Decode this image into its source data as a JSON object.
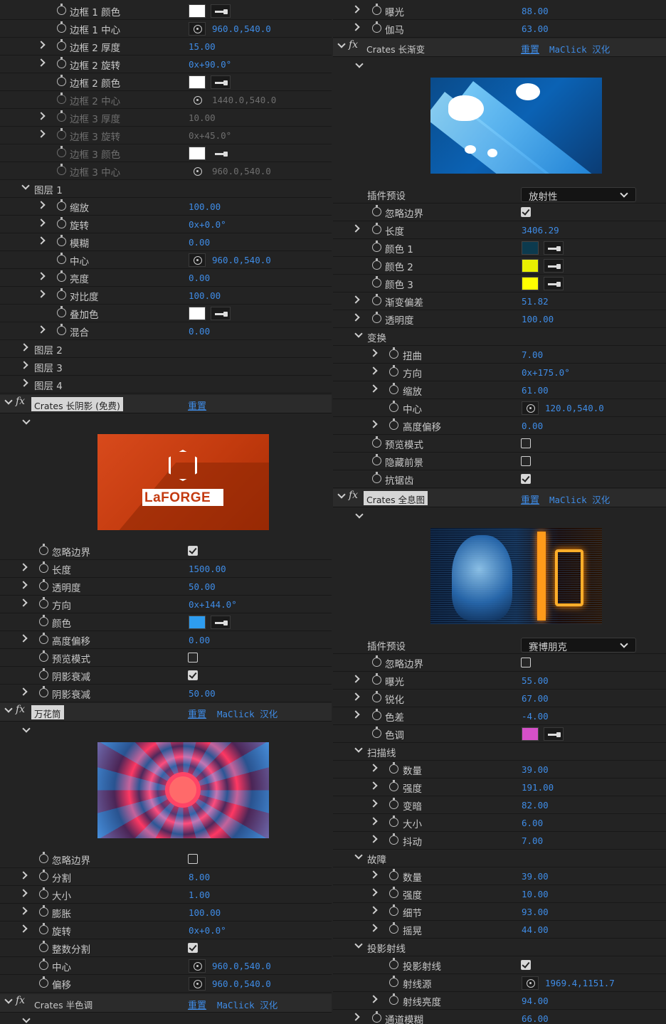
{
  "left": {
    "rows_top": [
      {
        "label": "边框 1 颜色",
        "swatch": "#ffffff"
      },
      {
        "label": "边框 1 中心",
        "value": "960.0,540.0"
      },
      {
        "label": "边框 2 厚度",
        "value": "15.00"
      },
      {
        "label": "边框 2 旋转",
        "value": "0x+90.0°"
      },
      {
        "label": "边框 2 颜色",
        "swatch": "#ffffff"
      },
      {
        "label": "边框 2 中心",
        "value": "1440.0,540.0"
      },
      {
        "label": "边框 3 厚度",
        "value": "10.00"
      },
      {
        "label": "边框 3 旋转",
        "value": "0x+45.0°"
      },
      {
        "label": "边框 3 颜色",
        "swatch": "#ffffff"
      },
      {
        "label": "边框 3 中心",
        "value": "960.0,540.0"
      },
      {
        "label": "图层 1"
      },
      {
        "label": "缩放",
        "value": "100.00"
      },
      {
        "label": "旋转",
        "value": "0x+0.0°"
      },
      {
        "label": "模糊",
        "value": "0.00"
      },
      {
        "label": "中心",
        "value": "960.0,540.0"
      },
      {
        "label": "亮度",
        "value": "0.00"
      },
      {
        "label": "对比度",
        "value": "100.00"
      },
      {
        "label": "叠加色",
        "swatch": "#ffffff"
      },
      {
        "label": "混合",
        "value": "0.00"
      },
      {
        "label": "图层 2"
      },
      {
        "label": "图层 3"
      },
      {
        "label": "图层 4"
      }
    ],
    "effect1": {
      "fx": "fx",
      "name": "Crates 长阴影 (免费)",
      "reset": "重置",
      "preview_text": "LaFORGE",
      "rows": [
        {
          "label": "忽略边界",
          "checked": true
        },
        {
          "label": "长度",
          "value": "1500.00"
        },
        {
          "label": "透明度",
          "value": "50.00"
        },
        {
          "label": "方向",
          "value": "0x+144.0°"
        },
        {
          "label": "颜色",
          "swatch": "#2e9df0"
        },
        {
          "label": "高度偏移",
          "value": "0.00"
        },
        {
          "label": "预览模式",
          "checked": false
        },
        {
          "label": "阴影衰减",
          "checked": true
        },
        {
          "label": "阴影衰减",
          "value": "50.00"
        }
      ]
    },
    "effect2": {
      "fx": "fx",
      "name": "万花筒",
      "reset": "重置",
      "maclick": "MaClick 汉化",
      "rows": [
        {
          "label": "忽略边界",
          "checked": false
        },
        {
          "label": "分割",
          "value": "8.00"
        },
        {
          "label": "大小",
          "value": "1.00"
        },
        {
          "label": "膨胀",
          "value": "100.00"
        },
        {
          "label": "旋转",
          "value": "0x+0.0°"
        },
        {
          "label": "整数分割",
          "checked": true
        },
        {
          "label": "中心",
          "value": "960.0,540.0"
        },
        {
          "label": "偏移",
          "value": "960.0,540.0"
        }
      ]
    },
    "effect3": {
      "fx": "fx",
      "name": "Crates 半色调",
      "reset": "重置",
      "maclick": "MaClick 汉化"
    }
  },
  "right": {
    "rows_top": [
      {
        "label": "曝光",
        "value": "88.00"
      },
      {
        "label": "伽马",
        "value": "63.00"
      }
    ],
    "effect1": {
      "fx": "fx",
      "name": "Crates 长渐变",
      "reset": "重置",
      "maclick": "MaClick 汉化",
      "preset_label": "插件预设",
      "preset_value": "放射性",
      "rows": [
        {
          "label": "忽略边界",
          "checked": true
        },
        {
          "label": "长度",
          "value": "3406.29"
        },
        {
          "label": "颜色 1",
          "swatch": "#0c3a4e"
        },
        {
          "label": "颜色 2",
          "swatch": "#e8f000"
        },
        {
          "label": "颜色 3",
          "swatch": "#ffff00"
        },
        {
          "label": "渐变偏差",
          "value": "51.82"
        },
        {
          "label": "透明度",
          "value": "100.00"
        },
        {
          "label": "变换"
        },
        {
          "label": "扭曲",
          "value": "7.00"
        },
        {
          "label": "方向",
          "value": "0x+175.0°"
        },
        {
          "label": "缩放",
          "value": "61.00"
        },
        {
          "label": "中心",
          "value": "120.0,540.0"
        },
        {
          "label": "高度偏移",
          "value": "0.00"
        },
        {
          "label": "预览模式",
          "checked": false
        },
        {
          "label": "隐藏前景",
          "checked": false
        },
        {
          "label": "抗锯齿",
          "checked": true
        }
      ]
    },
    "effect2": {
      "fx": "fx",
      "name": "Crates 全息图",
      "reset": "重置",
      "maclick": "MaClick 汉化",
      "preset_label": "插件预设",
      "preset_value": "赛博朋克",
      "rows": [
        {
          "label": "忽略边界",
          "checked": false
        },
        {
          "label": "曝光",
          "value": "55.00"
        },
        {
          "label": "锐化",
          "value": "67.00"
        },
        {
          "label": "色差",
          "value": "-4.00"
        },
        {
          "label": "色调",
          "swatch": "#d550c8"
        },
        {
          "label": "扫描线"
        },
        {
          "label": "数量",
          "value": "39.00"
        },
        {
          "label": "强度",
          "value": "191.00"
        },
        {
          "label": "变暗",
          "value": "82.00"
        },
        {
          "label": "大小",
          "value": "6.00"
        },
        {
          "label": "抖动",
          "value": "7.00"
        },
        {
          "label": "故障"
        },
        {
          "label": "数量",
          "value": "39.00"
        },
        {
          "label": "强度",
          "value": "10.00"
        },
        {
          "label": "细节",
          "value": "93.00"
        },
        {
          "label": "摇晃",
          "value": "44.00"
        },
        {
          "label": "投影射线"
        },
        {
          "label": "投影射线",
          "checked": true
        },
        {
          "label": "射线源",
          "value": "1969.4,1151.7"
        },
        {
          "label": "射线亮度",
          "value": "94.00"
        },
        {
          "label": "通道模糊",
          "value": "66.00"
        }
      ]
    }
  }
}
